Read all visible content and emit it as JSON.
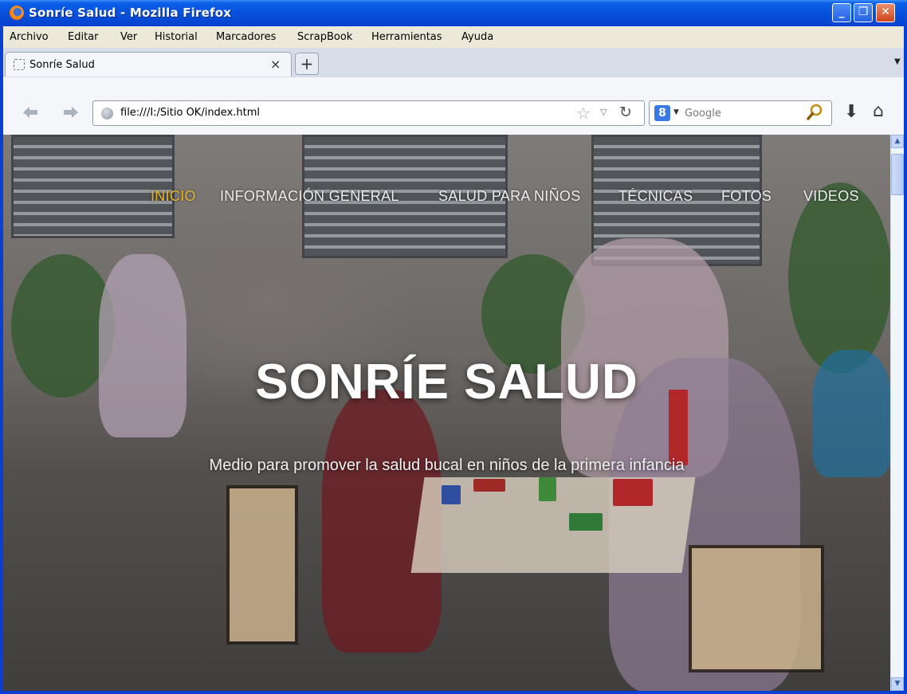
{
  "window": {
    "title": "Sonríe Salud - Mozilla Firefox",
    "controls": {
      "minimize": "_",
      "maximize": "❐",
      "close": "✕"
    }
  },
  "menubar": {
    "items": [
      "Archivo",
      "Editar",
      "Ver",
      "Historial",
      "Marcadores",
      "ScrapBook",
      "Herramientas",
      "Ayuda"
    ]
  },
  "tabs": {
    "active_label": "Sonríe Salud",
    "close_glyph": "×",
    "new_tab_glyph": "+",
    "list_glyph": "▼"
  },
  "navbar": {
    "back_icon": "arrow-left-icon",
    "forward_icon": "arrow-right-icon",
    "url": "file:///I:/Sitio OK/index.html",
    "star_glyph": "☆",
    "dropdown_glyph": "▽",
    "reload_glyph": "↻",
    "search_engine": "Google",
    "search_engine_badge": "8",
    "search_dropdown_glyph": "▼",
    "search_glyph": "⚲",
    "download_glyph": "⬇",
    "home_glyph": "⌂"
  },
  "site": {
    "nav": [
      "INICIO",
      "INFORMACIÓN GENERAL",
      "SALUD PARA NIÑOS",
      "TÉCNICAS",
      "FOTOS",
      "VIDEOS"
    ],
    "active_nav": "INICIO",
    "title": "SONRÍE SALUD",
    "subtitle": "Medio para promover la salud bucal en niños de la primera infancia",
    "colors": {
      "nav_active": "#e6b528",
      "nav_default": "#ececec"
    }
  },
  "scrollbar": {
    "up_glyph": "▲",
    "down_glyph": "▼"
  }
}
